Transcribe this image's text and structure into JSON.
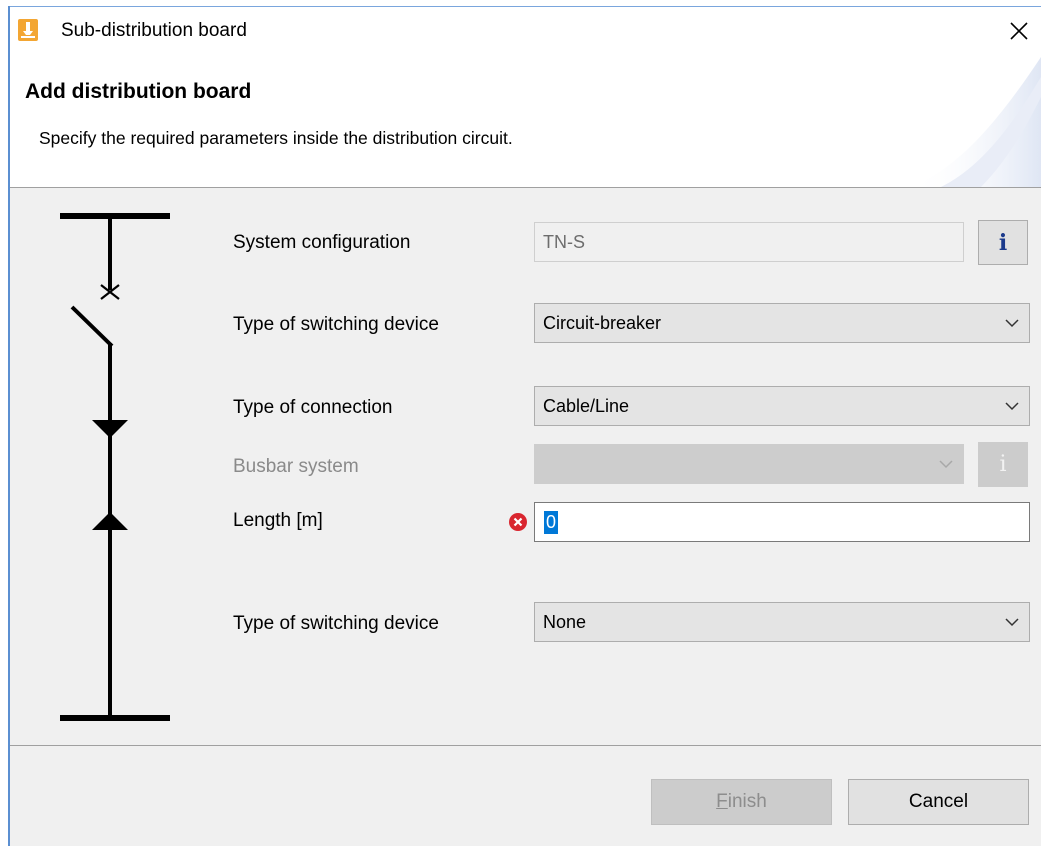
{
  "window": {
    "title": "Sub-distribution board",
    "close_icon": "close-icon",
    "app_icon": "app-icon"
  },
  "header": {
    "title": "Add distribution board",
    "description": "Specify the required parameters inside the distribution circuit."
  },
  "form": {
    "system_configuration": {
      "label": "System configuration",
      "value": "TN-S"
    },
    "switching_device_1": {
      "label": "Type of switching device",
      "value": "Circuit-breaker"
    },
    "connection": {
      "label": "Type of connection",
      "value": "Cable/Line"
    },
    "busbar_system": {
      "label": "Busbar system",
      "value": ""
    },
    "length": {
      "label": "Length [m]",
      "value": "0",
      "status": "error"
    },
    "switching_device_2": {
      "label": "Type of switching device",
      "value": "None"
    },
    "info_glyph": "i"
  },
  "footer": {
    "finish_mnemonic": "F",
    "finish_rest": "inish",
    "cancel_label": "Cancel"
  },
  "colors": {
    "accent": "#0078d7",
    "error": "#d9262f",
    "app_icon": "#f3a633"
  }
}
